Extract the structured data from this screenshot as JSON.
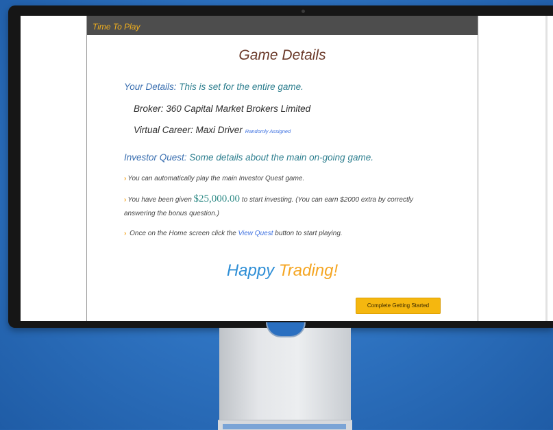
{
  "window": {
    "title": "Time To Play"
  },
  "dialog": {
    "heading": "Game Details",
    "your_details": {
      "label": "Your Details:",
      "description": " This is set for the entire game.",
      "broker": "Broker: 360 Capital Market Brokers Limited",
      "career": "Virtual Career: Maxi Driver",
      "career_tag": "Randomly Assigned"
    },
    "investor_quest": {
      "label": "Investor Quest:",
      "description": " Some details about the main on-going game.",
      "line1": "You can automatically play the main Investor Quest game.",
      "line2_pre": "You have been given ",
      "line2_amount": "$25,000.00",
      "line2_post": " to start investing. (You can earn $2000 extra by correctly answering the bonus question.)",
      "line3_pre": " Once on the Home screen click the ",
      "line3_link": "View Quest",
      "line3_post": " button to start playing."
    },
    "closing": {
      "word1": "Happy",
      "word2": "Trading!"
    },
    "complete_button": "Complete Getting Started"
  },
  "icons": {
    "bullet": "chevron-right-icon"
  },
  "colors": {
    "accent_orange": "#f5a623",
    "title_bar": "#4d4d4d",
    "heading": "#6b3a2a",
    "teal": "#2e7f8f",
    "blue": "#2f8fd6",
    "button": "#f5b70f"
  }
}
